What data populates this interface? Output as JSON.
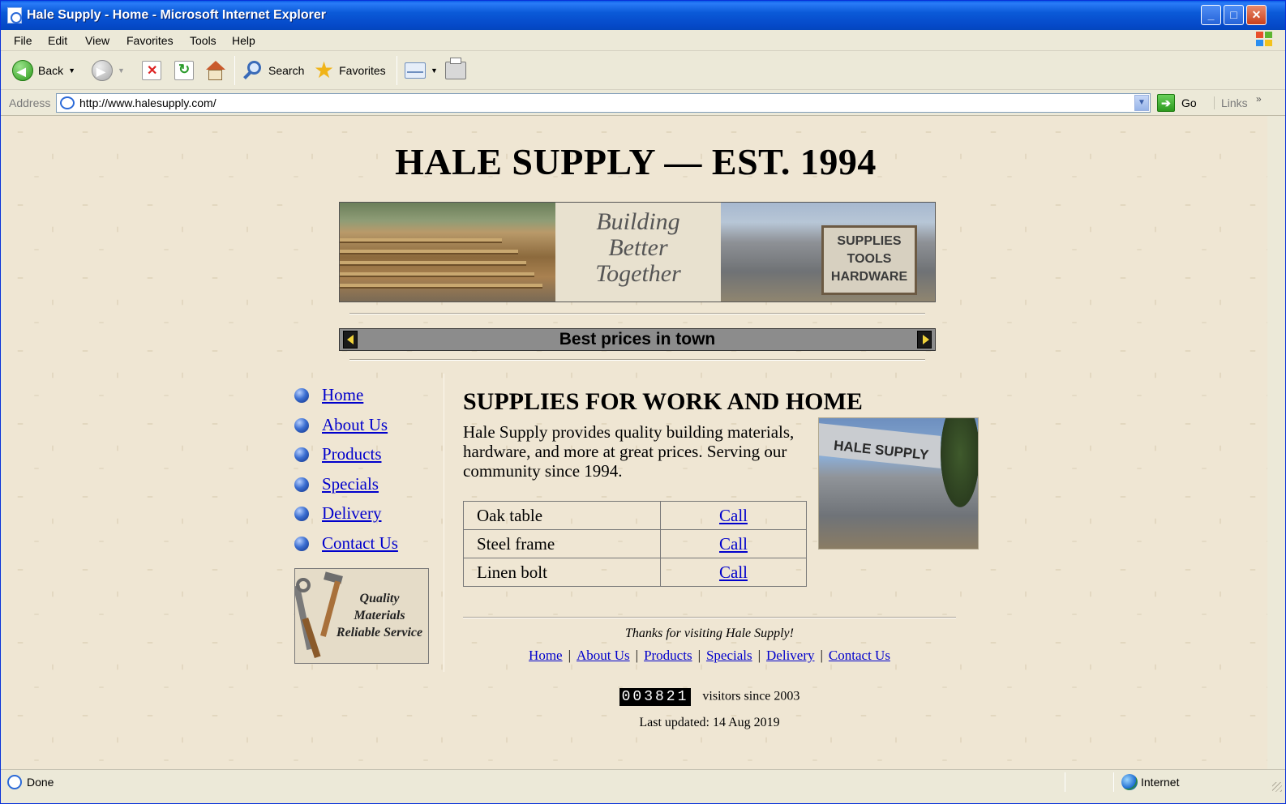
{
  "window": {
    "title": "Hale Supply - Home - Microsoft Internet Explorer"
  },
  "menubar": {
    "items": [
      "File",
      "Edit",
      "View",
      "Favorites",
      "Tools",
      "Help"
    ]
  },
  "toolbar": {
    "back_label": "Back",
    "search_label": "Search",
    "favorites_label": "Favorites"
  },
  "addressbar": {
    "label": "Address",
    "url": "http://www.halesupply.com/",
    "go_label": "Go",
    "links_label": "Links"
  },
  "page": {
    "site_title": "HALE SUPPLY — EST. 1994",
    "banner": {
      "tagline": [
        "Building",
        "Better",
        "Together"
      ],
      "sign_lines": [
        "SUPPLIES",
        "TOOLS",
        "HARDWARE"
      ]
    },
    "marquee_text": "Best prices in town",
    "nav": [
      "Home",
      "About Us",
      "Products",
      "Specials",
      "Delivery",
      "Contact Us"
    ],
    "promo_lines": [
      "Quality",
      "Materials",
      "Reliable Service"
    ],
    "section_title": "SUPPLIES FOR WORK AND HOME",
    "intro": "Hale Supply provides quality building materials, hardware, and more at great prices. Serving our community since 1994.",
    "store_sign": "HALE SUPPLY",
    "price_table": [
      {
        "item": "Oak table",
        "action": "Call"
      },
      {
        "item": "Steel frame",
        "action": "Call"
      },
      {
        "item": "Linen bolt",
        "action": "Call"
      }
    ],
    "thanks": "Thanks for visiting Hale Supply!",
    "footer_nav": [
      "Home",
      "About Us",
      "Products",
      "Specials",
      "Delivery",
      "Contact Us"
    ],
    "counter_value": "003821",
    "counter_label": "visitors since 2003",
    "last_updated": "Last updated: 14 Aug 2019"
  },
  "statusbar": {
    "status": "Done",
    "zone": "Internet"
  },
  "colors": {
    "link": "#0000cc",
    "titlebar": "#0b5ad8",
    "page_bg": "#efe6d3"
  }
}
